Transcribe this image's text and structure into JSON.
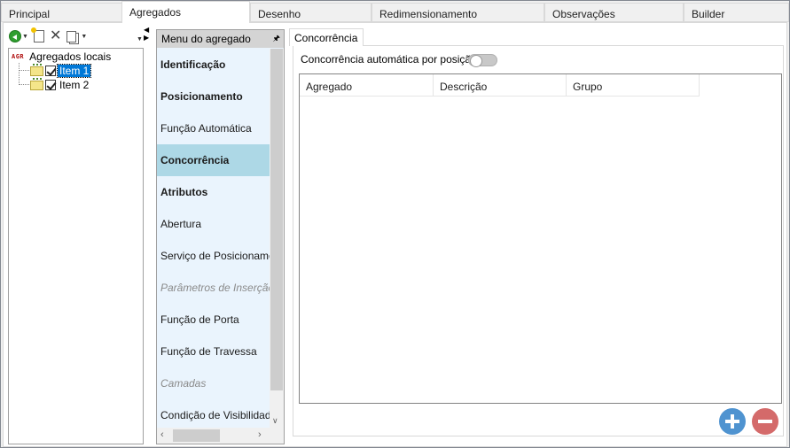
{
  "top_tabs": [
    {
      "label": "Principal",
      "active": false
    },
    {
      "label": "Agregados",
      "active": true
    },
    {
      "label": "Desenho",
      "active": false
    },
    {
      "label": "Redimensionamento",
      "active": false
    },
    {
      "label": "Observações",
      "active": false
    },
    {
      "label": "Builder",
      "active": false
    }
  ],
  "toolbar": {
    "back_icon": "green-back-arrow-icon",
    "new_icon": "new-item-icon",
    "delete_icon": "delete-x-icon",
    "copy_icon": "copy-pages-icon"
  },
  "tree": {
    "root": {
      "icon_text": "AGR",
      "label": "Agregados locais"
    },
    "items": [
      {
        "label": "Item 1",
        "checked": true,
        "selected": true
      },
      {
        "label": "Item 2",
        "checked": true,
        "selected": false
      }
    ]
  },
  "menu": {
    "header": "Menu do agregado",
    "items": [
      {
        "label": "Identificação",
        "style": "bold"
      },
      {
        "label": "Posicionamento",
        "style": "bold"
      },
      {
        "label": "Função Automática",
        "style": "normal"
      },
      {
        "label": "Concorrência",
        "style": "active"
      },
      {
        "label": "Atributos",
        "style": "bold"
      },
      {
        "label": "Abertura",
        "style": "normal"
      },
      {
        "label": "Serviço de Posicionamento",
        "style": "normal"
      },
      {
        "label": "Parâmetros de Inserção",
        "style": "disabled"
      },
      {
        "label": "Função de Porta",
        "style": "normal"
      },
      {
        "label": "Função de Travessa",
        "style": "normal"
      },
      {
        "label": "Camadas",
        "style": "disabled"
      },
      {
        "label": "Condição de Visibilidade",
        "style": "normal"
      }
    ]
  },
  "concorrencia": {
    "tab_label": "Concorrência",
    "auto_label": "Concorrência automática por posição",
    "auto_enabled": false,
    "columns": [
      "Agregado",
      "Descrição",
      "Grupo"
    ],
    "rows": []
  },
  "colors": {
    "selected_blue": "#0078d7",
    "menu_active": "#add8e6",
    "menu_bg": "#eaf4fd",
    "add_button": "#4f93d0",
    "remove_button": "#d46a6a"
  }
}
